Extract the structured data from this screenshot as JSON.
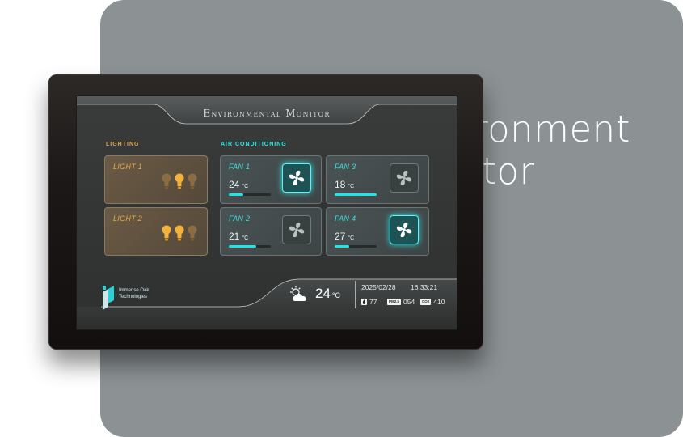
{
  "hero": {
    "line1": "Environment",
    "line2": "Monitor"
  },
  "screen": {
    "title": "Environmental Monitor"
  },
  "sections": {
    "lighting": "LIGHTING",
    "air_conditioning": "AIR CONDITIONING"
  },
  "lights": [
    {
      "name": "LIGHT 1",
      "bulbs": [
        "off",
        "on",
        "off"
      ]
    },
    {
      "name": "LIGHT 2",
      "bulbs": [
        "on",
        "on",
        "off"
      ]
    }
  ],
  "fans": [
    {
      "name": "FAN 1",
      "temp": "24",
      "unit": "°C",
      "level": 0.35,
      "state": "on"
    },
    {
      "name": "FAN 3",
      "temp": "18",
      "unit": "°C",
      "level": 1.0,
      "state": "off"
    },
    {
      "name": "FAN 2",
      "temp": "21",
      "unit": "°C",
      "level": 0.65,
      "state": "off"
    },
    {
      "name": "FAN 4",
      "temp": "27",
      "unit": "°C",
      "level": 0.35,
      "state": "on"
    }
  ],
  "brand": {
    "line1": "Immense Oak",
    "line2": "Technologies"
  },
  "status": {
    "outdoor_temp": "24",
    "outdoor_unit": "°C",
    "weather_icon": "partly-cloudy-icon",
    "date": "2025/02/28",
    "time": "16:33:21",
    "humidity": "77",
    "pm25_tag": "PM2.5",
    "pm25": "054",
    "co2_tag": "CO2",
    "co2": "410"
  },
  "colors": {
    "accent": "#1fe6e6",
    "amber": "#e5aa45",
    "card_bg": "#8c9294"
  }
}
